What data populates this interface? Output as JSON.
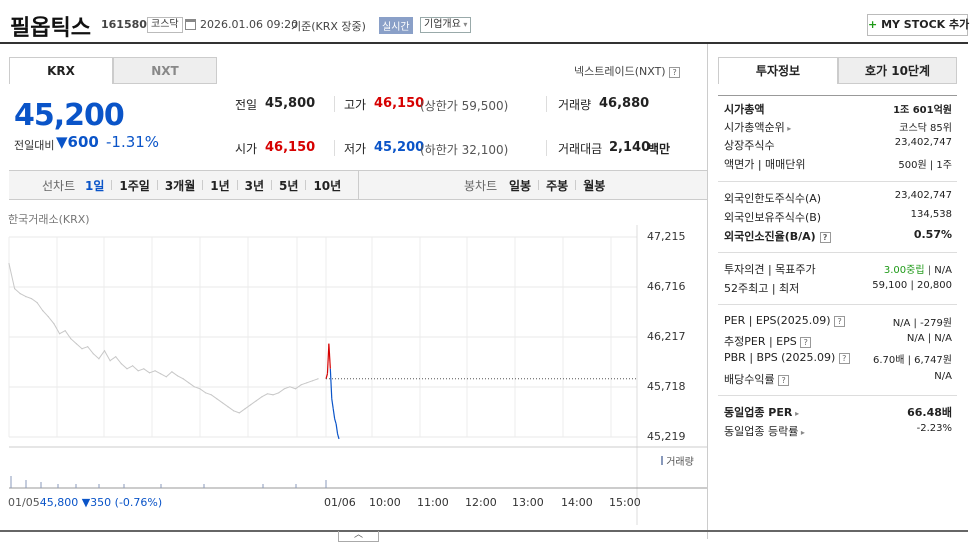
{
  "header": {
    "company_name": "필옵틱스",
    "code": "161580",
    "market_badge": "코스닥",
    "datetime": "2026.01.06 09:20",
    "basis": "기준(KRX 장중)",
    "realtime_badge": "실시간",
    "company_overview": "기업개요",
    "my_stock_button": "MY STOCK 추가"
  },
  "exchange_tabs": {
    "krx": "KRX",
    "nxt": "NXT",
    "nextrade": "넥스트레이드(NXT)"
  },
  "price": {
    "current": "45,200",
    "change_label": "전일대비",
    "change": "600",
    "change_pct": "-1.31%"
  },
  "summary": {
    "prev_close_label": "전일",
    "prev_close": "45,800",
    "high_label": "고가",
    "high": "46,150",
    "upper_limit": "(상한가 59,500)",
    "volume_label": "거래량",
    "volume": "46,880",
    "open_label": "시가",
    "open": "46,150",
    "low_label": "저가",
    "low": "45,200",
    "lower_limit": "(하한가 32,100)",
    "amount_label": "거래대금",
    "amount": "2,140",
    "amount_unit": "백만"
  },
  "period_tabs": {
    "line_label": "선차트",
    "line_items": [
      "1일",
      "1주일",
      "3개월",
      "1년",
      "3년",
      "5년",
      "10년"
    ],
    "candle_label": "봉차트",
    "candle_items": [
      "일봉",
      "주봉",
      "월봉"
    ]
  },
  "chart": {
    "source": "한국거래소(KRX)",
    "volume_label": "거래량",
    "y_ticks": [
      "47,215",
      "46,716",
      "46,217",
      "45,718",
      "45,219"
    ],
    "x_ticks": [
      "01/06",
      "10:00",
      "11:00",
      "12:00",
      "13:00",
      "14:00",
      "15:00"
    ],
    "prev_day_date": "01/05",
    "prev_day_close": "45,800",
    "prev_day_change": "▼350",
    "prev_day_pct": "(-0.76%)"
  },
  "chart_data": {
    "type": "line",
    "ylim": [
      45219,
      47215
    ],
    "series": [
      {
        "values": [
          46950,
          46700,
          46650,
          46620,
          46600,
          46560,
          46480,
          46420,
          46350,
          46250,
          46280,
          46200,
          46150,
          46100,
          46120,
          46050,
          46000,
          46080,
          45980,
          46020,
          45950,
          45900,
          45930,
          45880,
          45900,
          45860,
          45880,
          45850,
          45820,
          45870,
          45830,
          45800,
          45760,
          45720,
          45700,
          45660,
          45640,
          45600,
          45560,
          45520,
          45480,
          45460,
          45500,
          45540,
          45580,
          45620,
          45650,
          45640,
          45660,
          45700,
          45720,
          45700,
          45740,
          45760,
          45780,
          45800
        ]
      },
      {
        "values": [
          45800,
          45850,
          46150,
          45900,
          45600,
          45500,
          45400,
          45350,
          45250,
          45200
        ]
      }
    ]
  },
  "right_panel": {
    "tabs": [
      "투자정보",
      "호가 10단계"
    ],
    "market_cap_label": "시가총액",
    "market_cap": "1조 601억원",
    "market_cap_rank_label": "시가총액순위",
    "market_cap_rank": "코스닥 85위",
    "listed_shares_label": "상장주식수",
    "listed_shares": "23,402,747",
    "par_label": "액면가 | 매매단위",
    "par": "500원 | 1주",
    "foreign_limit_label": "외국인한도주식수(A)",
    "foreign_limit": "23,402,747",
    "foreign_hold_label": "외국인보유주식수(B)",
    "foreign_hold": "134,538",
    "foreign_ratio_label": "외국인소진율(B/A)",
    "foreign_ratio": "0.57%",
    "opinion_label": "투자의견 | 목표주가",
    "opinion": "3.00중립",
    "target": "N/A",
    "w52_label": "52주최고 | 최저",
    "w52": "59,100 | 20,800",
    "per_label": "PER | EPS(2025.09)",
    "per": "N/A | -279원",
    "est_per_label": "추정PER | EPS",
    "est_per": "N/A | N/A",
    "pbr_label": "PBR | BPS (2025.09)",
    "pbr": "6.70배 | 6,747원",
    "dividend_label": "배당수익률",
    "dividend": "N/A",
    "sector_per_label": "동일업종 PER",
    "sector_per": "66.48배",
    "sector_change_label": "동일업종 등락률",
    "sector_change": "-2.23%"
  },
  "colors": {
    "up": "#d60000",
    "down": "#0a54c8",
    "neutral_line": "#c8c8c8"
  }
}
